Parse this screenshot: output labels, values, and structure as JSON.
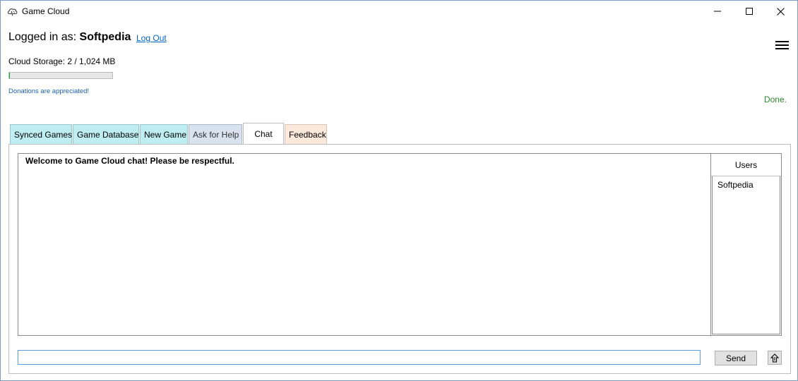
{
  "window": {
    "title": "Game Cloud",
    "icon": "cloud-game-icon"
  },
  "account": {
    "logged_in_prefix": "Logged in as:",
    "username": "Softpedia",
    "logout_label": "Log Out"
  },
  "storage": {
    "label": "Cloud Storage: 2 / 1,024 MB",
    "used_fraction": 0.002
  },
  "donations_text": "Donations are appreciated!",
  "status_text": "Done.",
  "tabs": [
    {
      "label": "Synced Games"
    },
    {
      "label": "Game Database"
    },
    {
      "label": "New Game"
    },
    {
      "label": "Ask for Help"
    },
    {
      "label": "Chat",
      "selected": true
    },
    {
      "label": "Feedback"
    }
  ],
  "chat": {
    "welcome_message": "Welcome to Game Cloud chat! Please be respectful.",
    "input_value": "",
    "send_label": "Send"
  },
  "users": {
    "header": "Users",
    "list": [
      "Softpedia"
    ]
  },
  "colors": {
    "status_done": "#2d8a2d",
    "link": "#0066cc",
    "tab_cyan": "#bfeef2",
    "tab_feedback": "#fbe9dc"
  }
}
